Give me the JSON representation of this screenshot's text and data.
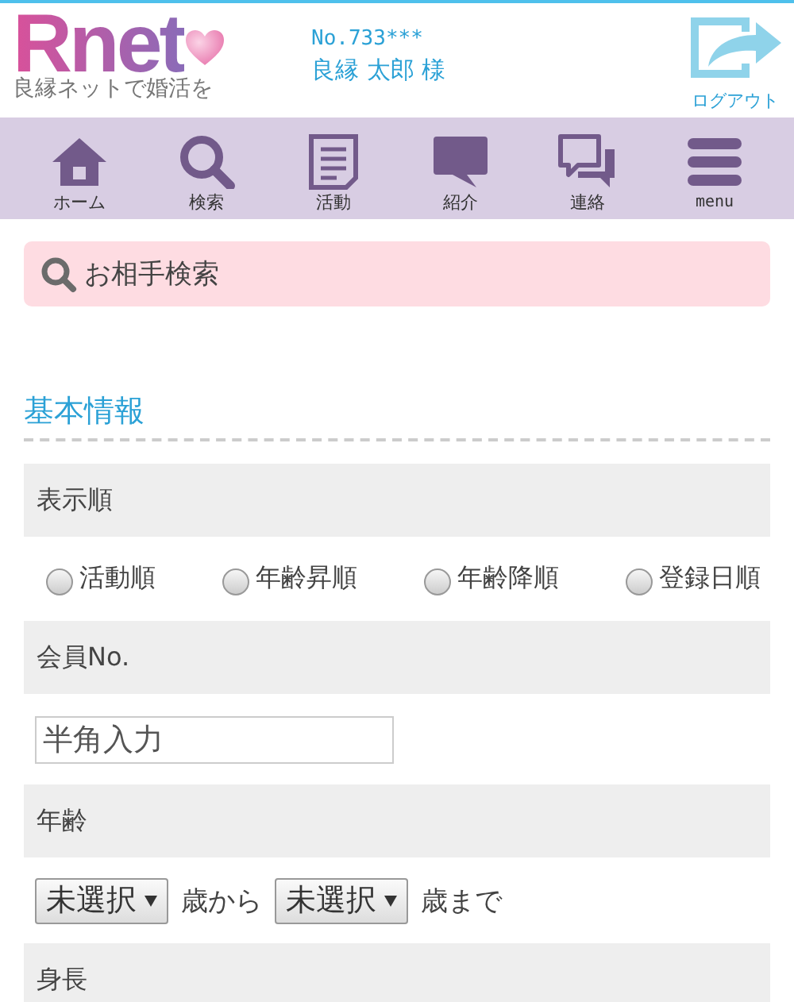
{
  "header": {
    "logo": "Rnet",
    "tagline": "良縁ネットで婚活を",
    "member_no": "No.733***",
    "member_name": "良縁 太郎 様",
    "logout": "ログアウト"
  },
  "nav": [
    {
      "label": "ホーム"
    },
    {
      "label": "検索"
    },
    {
      "label": "活動"
    },
    {
      "label": "紹介"
    },
    {
      "label": "連絡"
    },
    {
      "label": "menu"
    }
  ],
  "search_title": "お相手検索",
  "section_title": "基本情報",
  "fields": [
    {
      "label": "表示順",
      "kind": "radio",
      "options": [
        {
          "label": "活動順",
          "selected": false
        },
        {
          "label": "年齢昇順",
          "selected": false
        },
        {
          "label": "年齢降順",
          "selected": false
        },
        {
          "label": "登録日順",
          "selected": false
        }
      ]
    },
    {
      "label": "会員No.",
      "kind": "text",
      "placeholder": "半角入力"
    },
    {
      "label": "年齢",
      "kind": "range",
      "from": "未選択",
      "from_suffix": "歳から",
      "to": "未選択",
      "to_suffix": "歳まで"
    },
    {
      "label": "身長",
      "kind": "none"
    }
  ]
}
